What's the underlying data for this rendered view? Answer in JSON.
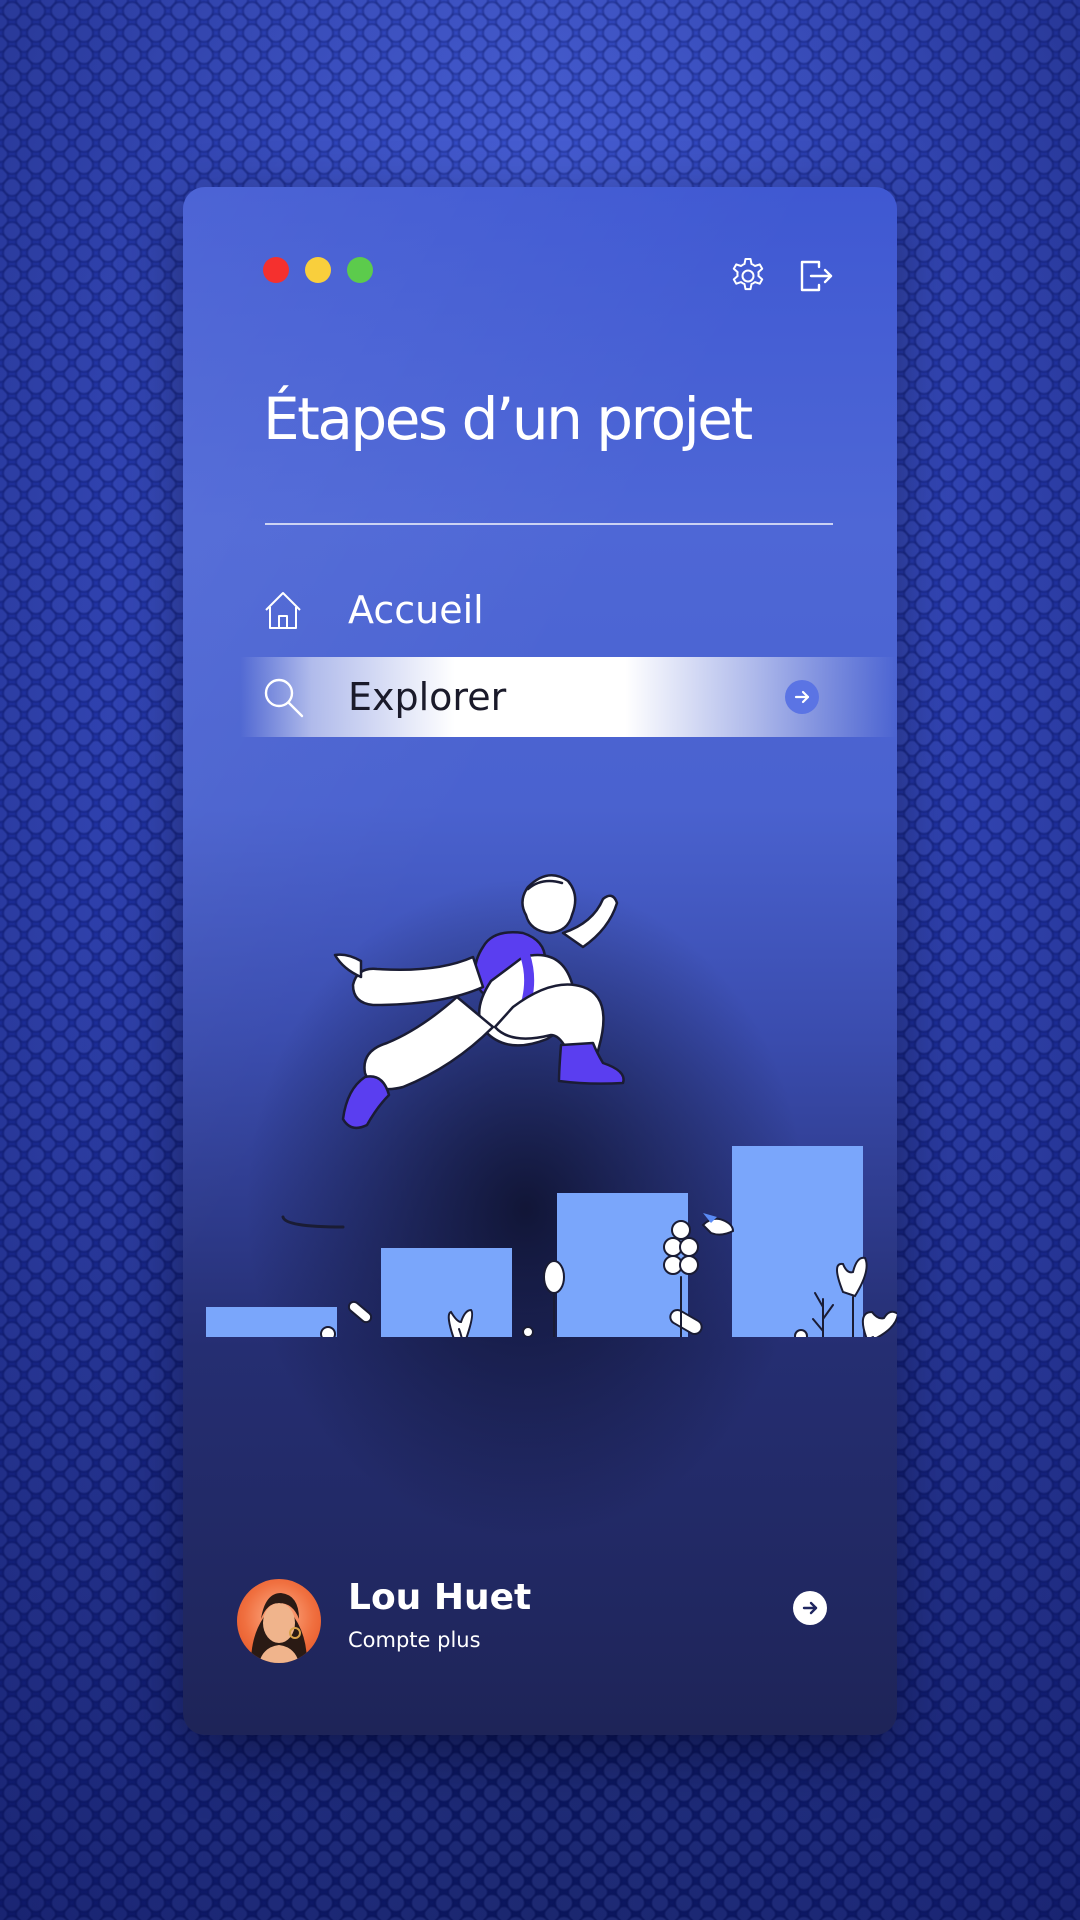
{
  "window": {
    "controls": [
      {
        "name": "close",
        "color": "#f5302e"
      },
      {
        "name": "minimize",
        "color": "#f9cf3c"
      },
      {
        "name": "maximize",
        "color": "#5ccb4c"
      }
    ],
    "icons": [
      "settings-gear-icon",
      "logout-icon"
    ]
  },
  "title": "Étapes d’un projet",
  "nav": {
    "home_label": "Accueil",
    "explore_label": "Explorer"
  },
  "user": {
    "name": "Lou Huet",
    "subtitle": "Compte plus"
  },
  "colors": {
    "accent": "#5b74e4",
    "bars": "#7aa6fb",
    "figure_accent": "#5a3ef0"
  }
}
